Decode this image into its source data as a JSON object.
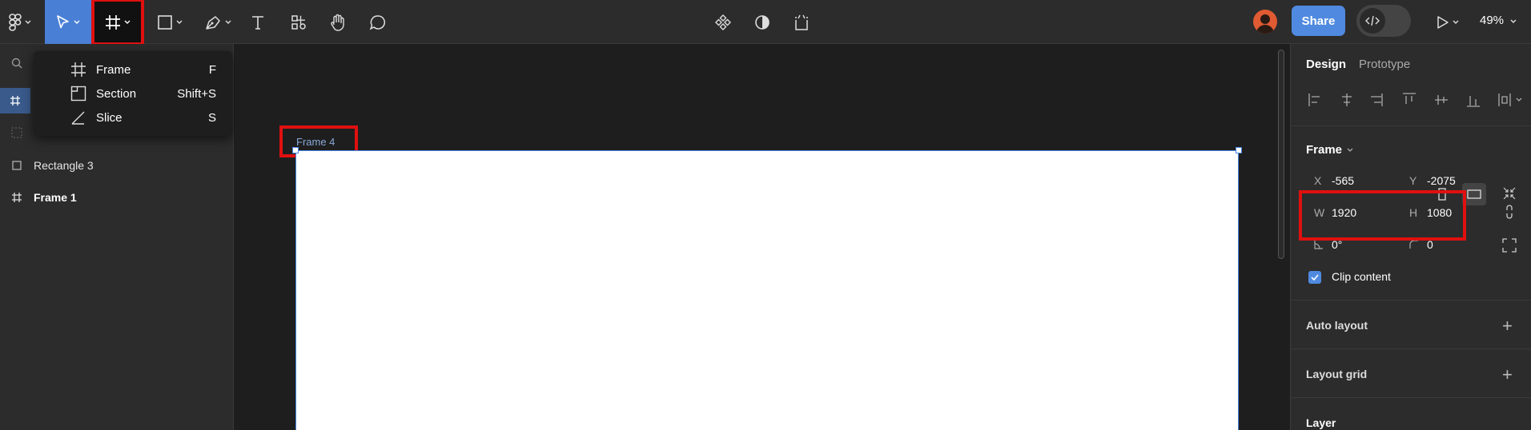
{
  "toolbar": {
    "share_label": "Share",
    "zoom": "49%"
  },
  "left_panel": {
    "layers": [
      {
        "label": "Rectangle 3",
        "icon": "rectangle-icon",
        "bold": false
      },
      {
        "label": "Frame 1",
        "icon": "frame-icon",
        "bold": true
      }
    ]
  },
  "frame_menu": {
    "items": [
      {
        "label": "Frame",
        "shortcut": "F",
        "icon": "frame-icon"
      },
      {
        "label": "Section",
        "shortcut": "Shift+S",
        "icon": "section-icon"
      },
      {
        "label": "Slice",
        "shortcut": "S",
        "icon": "slice-icon"
      }
    ]
  },
  "canvas": {
    "frame_label": "Frame 4"
  },
  "right_panel": {
    "tabs": [
      "Design",
      "Prototype"
    ],
    "frame_heading": "Frame",
    "x_label": "X",
    "x_value": "-565",
    "y_label": "Y",
    "y_value": "-2075",
    "w_label": "W",
    "w_value": "1920",
    "h_label": "H",
    "h_value": "1080",
    "rotation": "0°",
    "radius": "0",
    "clip_content": "Clip content",
    "auto_layout": "Auto layout",
    "layout_grid": "Layout grid",
    "layer": "Layer"
  },
  "colors": {
    "accent": "#4f8ae0",
    "highlight": "#e01010"
  }
}
